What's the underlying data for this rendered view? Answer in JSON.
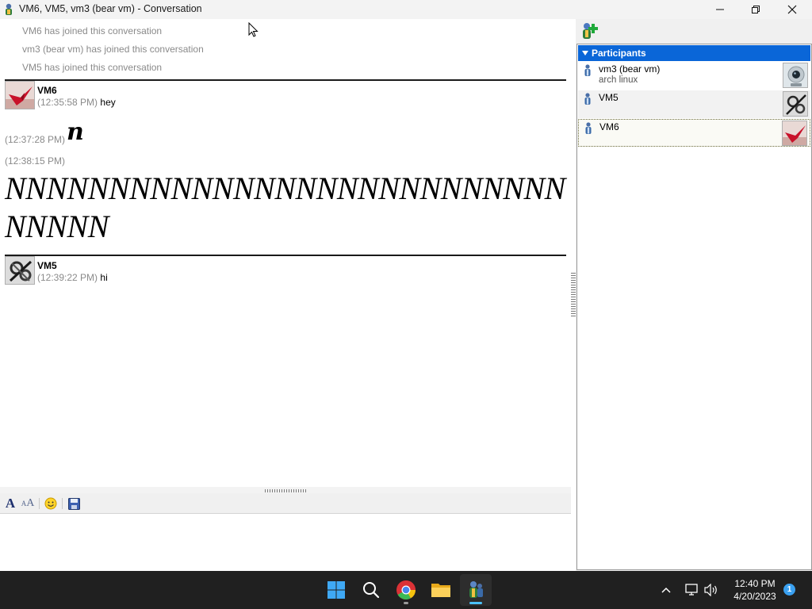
{
  "window": {
    "title": "VM6, VM5, vm3 (bear vm) - Conversation"
  },
  "conversation": {
    "system_messages": [
      "VM6 has joined this conversation",
      "vm3 (bear vm) has joined this conversation",
      "VM5 has joined this conversation"
    ],
    "blocks": [
      {
        "sender": "VM6",
        "avatar_icon": "origami-crane-avatar",
        "messages": [
          {
            "time": "(12:35:58 PM)",
            "text": "hey"
          },
          {
            "time": "(12:37:28 PM)",
            "text": "n"
          },
          {
            "time": "(12:38:15 PM)",
            "text": "NNNNNNNNNNNNNNNNNNNNNNNNNNNNNNNN"
          }
        ]
      },
      {
        "sender": "VM5",
        "avatar_icon": "gears-avatar",
        "messages": [
          {
            "time": "(12:39:22 PM)",
            "text": "hi"
          }
        ]
      }
    ]
  },
  "toolbar": {
    "font_icon": "font-icon",
    "font_size_icon": "font-size-icon",
    "smiley_icon": "smiley-icon",
    "save_icon": "save-icon",
    "font_glyph": "A",
    "font_size_glyph": "A"
  },
  "compose": {
    "value": ""
  },
  "participants": {
    "header": "Participants",
    "add_icon": "add-contact-icon",
    "list": [
      {
        "name": "vm3 (bear vm)",
        "status_message": "arch linux",
        "avatar_icon": "webcam-avatar",
        "selected": false
      },
      {
        "name": "VM5",
        "status_message": "",
        "avatar_icon": "gears-avatar",
        "selected": false
      },
      {
        "name": "VM6",
        "status_message": "",
        "avatar_icon": "origami-crane-avatar",
        "selected": true
      }
    ]
  },
  "taskbar": {
    "apps": [
      "windows-start-icon",
      "search-icon",
      "chrome-icon",
      "file-explorer-icon",
      "pidgin-icon"
    ],
    "tray_icons": [
      "chevron-up-icon",
      "network-icon",
      "volume-icon"
    ],
    "time": "12:40 PM",
    "date": "4/20/2023",
    "notification_count": "1"
  },
  "colors": {
    "participants_header": "#0a66d8",
    "timestamp": "#8a8a8a",
    "taskbar": "#202020",
    "notification_badge": "#3aa0f0"
  }
}
